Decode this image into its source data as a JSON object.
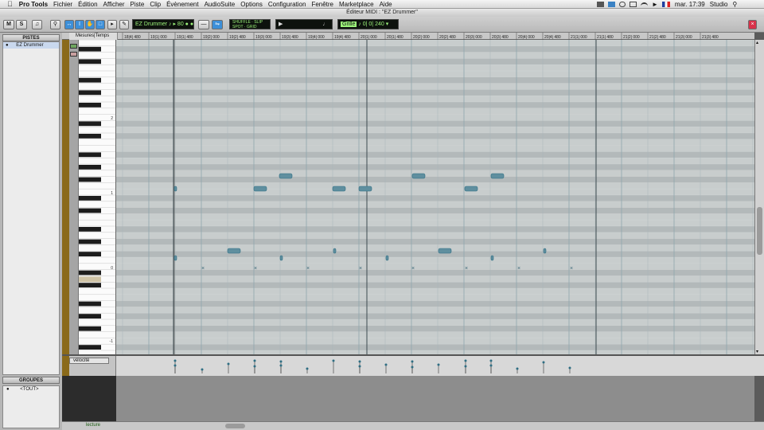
{
  "menubar": {
    "apple": "",
    "app": "Pro Tools",
    "items": [
      "Fichier",
      "Édition",
      "Afficher",
      "Piste",
      "Clip",
      "Évènement",
      "AudioSuite",
      "Options",
      "Configuration",
      "Fenêtre",
      "Marketplace",
      "Aide"
    ],
    "clock": "mar. 17:39",
    "user": "Studio"
  },
  "window": {
    "title": "Éditeur MIDI : \"EZ Drummer\""
  },
  "toolbar": {
    "track_select": "EZ Drummer",
    "note_value": "80",
    "counter": "0| 0| 240",
    "grid_label": "Grille",
    "mode_line1": "SHUFFLE  ·  SLIP",
    "mode_line2": "SPOT  ·  GRID"
  },
  "tracks_panel": {
    "header": "PISTES",
    "track_name": "EZ Drummer"
  },
  "groups_panel": {
    "header": "GROUPES",
    "item": "<TOUT>"
  },
  "ruler": {
    "label": "Mesures|Temps",
    "ticks": [
      "18|4| 480",
      "19|1| 000",
      "19|1| 480",
      "19|2| 000",
      "19|2| 480",
      "19|3| 000",
      "19|3| 480",
      "19|4| 000",
      "19|4| 480",
      "20|1| 000",
      "20|1| 480",
      "20|2| 000",
      "20|2| 480",
      "20|3| 000",
      "20|3| 480",
      "20|4| 000",
      "20|4| 480",
      "21|1| 000",
      "21|1| 480",
      "21|2| 000",
      "21|2| 480",
      "21|3| 000",
      "21|3| 480"
    ]
  },
  "piano": {
    "octave_labels": [
      "2",
      "1",
      "0",
      "-1"
    ]
  },
  "velocity": {
    "lane_label": "vélocité"
  },
  "status": {
    "mode": "lecture"
  },
  "colors": {
    "note": "#5f8f9f",
    "note_dark": "#2f6e83",
    "accent_green": "#9cf37a",
    "track_strip": "#8a6a1a"
  }
}
